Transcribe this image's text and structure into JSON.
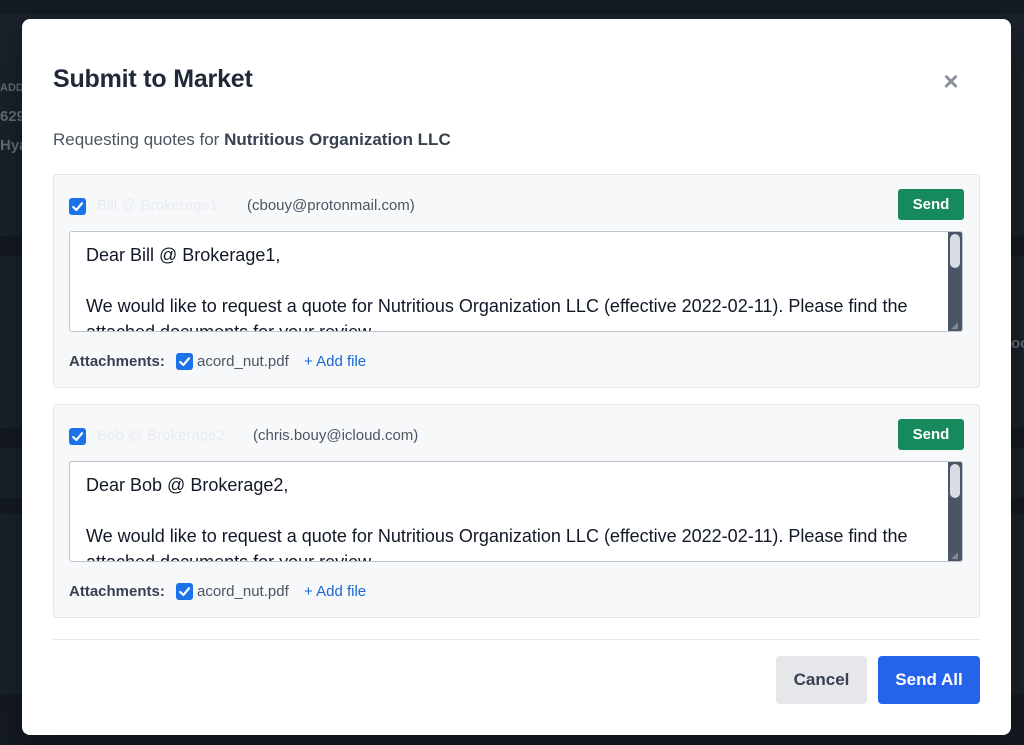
{
  "background": {
    "fragments": [
      "ADD",
      "629",
      "Hya",
      "ooc"
    ]
  },
  "modal": {
    "title": "Submit to Market",
    "close_icon": "close-icon",
    "subtitle_prefix": "Requesting quotes for ",
    "company": "Nutritious Organization LLC"
  },
  "recipients": [
    {
      "checked": true,
      "name": "Bill @ Brokerage1",
      "email": "(cbouy@protonmail.com)",
      "send_label": "Send",
      "message": "Dear Bill @ Brokerage1,\n\nWe would like to request a quote for Nutritious Organization LLC (effective 2022-02-11). Please find the attached documents for your review.",
      "attachments_label": "Attachments:",
      "attachment_file": "acord_nut.pdf",
      "attachment_checked": true,
      "add_file_label": "+ Add file"
    },
    {
      "checked": true,
      "name": "Bob @ Brokerage2",
      "email": "(chris.bouy@icloud.com)",
      "send_label": "Send",
      "message": "Dear Bob @ Brokerage2,\n\nWe would like to request a quote for Nutritious Organization LLC (effective 2022-02-11). Please find the attached documents for your review.",
      "attachments_label": "Attachments:",
      "attachment_file": "acord_nut.pdf",
      "attachment_checked": true,
      "add_file_label": "+ Add file"
    }
  ],
  "footer": {
    "cancel_label": "Cancel",
    "send_all_label": "Send All"
  },
  "colors": {
    "send_green": "#168a5c",
    "primary_blue": "#2563eb",
    "checkbox_blue": "#1a73e8",
    "link_blue": "#1a67d2"
  }
}
